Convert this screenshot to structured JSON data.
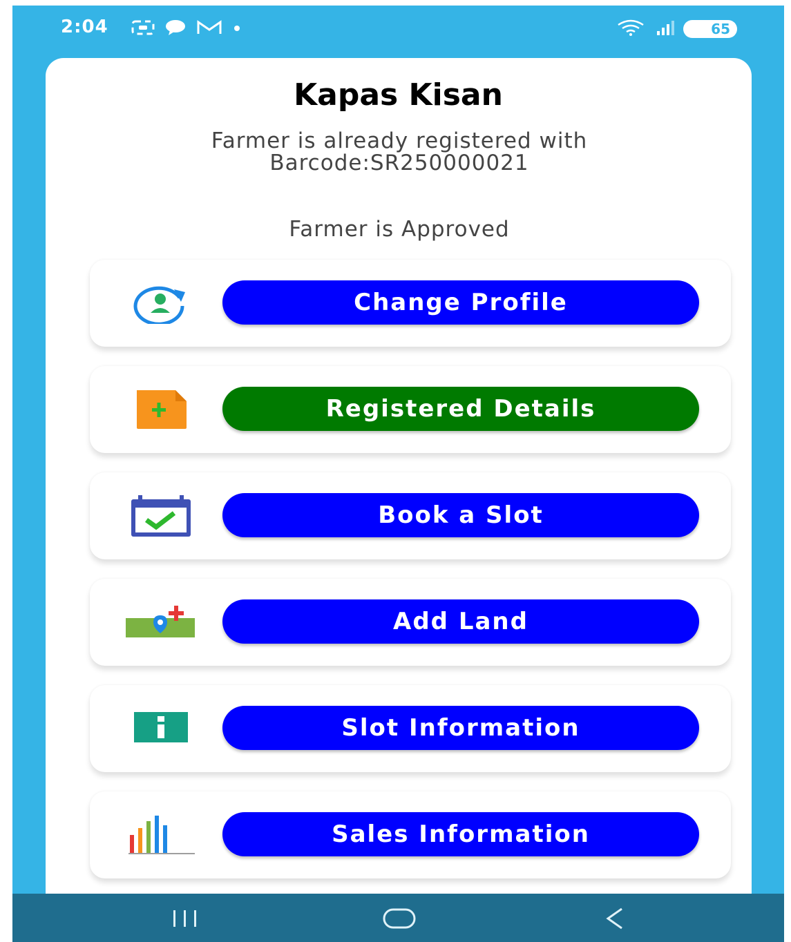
{
  "status_bar": {
    "time": "2:04",
    "battery": "65",
    "icons": [
      "screenshot-icon",
      "chat-icon",
      "gmail-icon",
      "dot-icon",
      "wifi-icon",
      "signal-icon",
      "battery-icon"
    ]
  },
  "app": {
    "title": "Kapas Kisan",
    "registered_line1": "Farmer is already registered with",
    "registered_line2": "Barcode:SR250000021",
    "status": "Farmer is Approved"
  },
  "menu": [
    {
      "label": "Change Profile",
      "icon": "profile-refresh-icon",
      "color": "#0000ff"
    },
    {
      "label": "Registered Details",
      "icon": "document-add-icon",
      "color": "#007a00"
    },
    {
      "label": "Book a Slot",
      "icon": "calendar-check-icon",
      "color": "#0000ff"
    },
    {
      "label": "Add Land",
      "icon": "land-pin-icon",
      "color": "#0000ff"
    },
    {
      "label": "Slot Information",
      "icon": "info-icon",
      "color": "#0000ff"
    },
    {
      "label": "Sales Information",
      "icon": "bar-chart-icon",
      "color": "#0000ff"
    }
  ],
  "nav": {
    "icons": [
      "recent-apps-icon",
      "home-icon",
      "back-icon"
    ]
  },
  "colors": {
    "background": "#35b4e6",
    "primary_button": "#0000ff",
    "secondary_button": "#007a00",
    "nav_bar": "#1f6d8e"
  }
}
